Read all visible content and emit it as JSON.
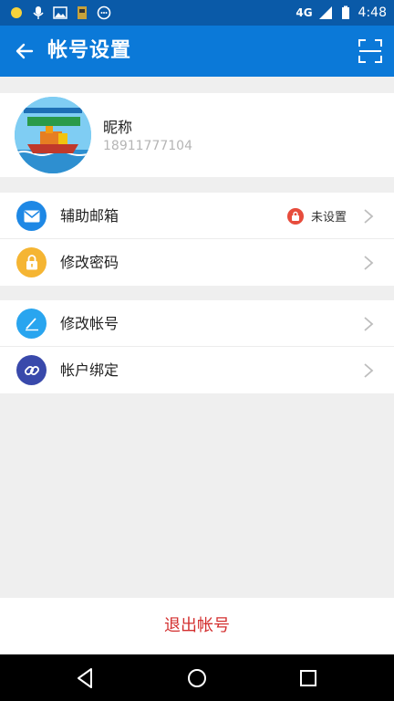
{
  "status_bar": {
    "network": "4G",
    "time": "4:48"
  },
  "app_bar": {
    "title": "帐号设置"
  },
  "profile": {
    "nickname": "昵称",
    "phone": "18911777104"
  },
  "settings_group_1": [
    {
      "label": "辅助邮箱",
      "icon": "mail-icon",
      "icon_color": "#1e88e5",
      "status": "未设置"
    },
    {
      "label": "修改密码",
      "icon": "lock-icon",
      "icon_color": "#f5b533"
    }
  ],
  "settings_group_2": [
    {
      "label": "修改帐号",
      "icon": "edit-icon",
      "icon_color": "#29a5ef"
    },
    {
      "label": "帐户绑定",
      "icon": "link-icon",
      "icon_color": "#3949ab"
    }
  ],
  "logout": {
    "label": "退出帐号"
  },
  "colors": {
    "status_bar": "#0a5aa8",
    "app_bar": "#0b79d8",
    "logout_text": "#d32f2f",
    "background": "#efefef"
  }
}
